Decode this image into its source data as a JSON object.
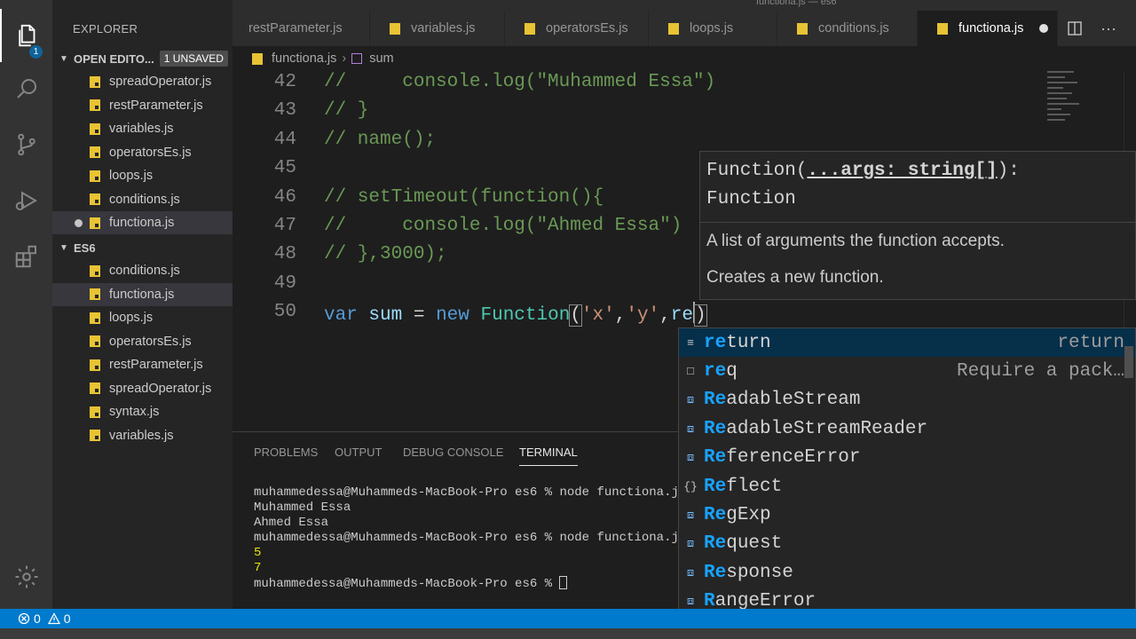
{
  "window": {
    "title": "functiona.js — es6"
  },
  "activity_bar": {
    "items": [
      {
        "name": "explorer-icon",
        "active": true,
        "badge": "1"
      },
      {
        "name": "search-icon"
      },
      {
        "name": "source-control-icon"
      },
      {
        "name": "run-debug-icon"
      },
      {
        "name": "extensions-icon"
      }
    ],
    "settings": "gear-icon"
  },
  "sidebar": {
    "title": "EXPLORER",
    "open_editors": {
      "label": "OPEN EDITO...",
      "badge": "1 UNSAVED",
      "files": [
        "spreadOperator.js",
        "restParameter.js",
        "variables.js",
        "operatorsEs.js",
        "loops.js",
        "conditions.js",
        "functiona.js"
      ]
    },
    "folder": {
      "label": "ES6",
      "files": [
        "conditions.js",
        "functiona.js",
        "loops.js",
        "operatorsEs.js",
        "restParameter.js",
        "spreadOperator.js",
        "syntax.js",
        "variables.js"
      ]
    }
  },
  "tabs": [
    {
      "label": "restParameter.js",
      "active": false
    },
    {
      "label": "variables.js",
      "active": false
    },
    {
      "label": "operatorsEs.js",
      "active": false
    },
    {
      "label": "loops.js",
      "active": false
    },
    {
      "label": "conditions.js",
      "active": false
    },
    {
      "label": "functiona.js",
      "active": true,
      "modified": true
    }
  ],
  "breadcrumb": {
    "file": "functiona.js",
    "symbol": "sum"
  },
  "editor": {
    "line_numbers": [
      "42",
      "43",
      "44",
      "45",
      "46",
      "47",
      "48",
      "49",
      "50"
    ],
    "lines": {
      "l42a": "//",
      "l42b": "console.log(\"Muhammed Essa\")",
      "l43": "// }",
      "l44": "// name();",
      "l46": "// setTimeout(function(){",
      "l47a": "//",
      "l47b": "console.log(\"Ahmed Essa\")",
      "l48": "// },3000);",
      "l50_kw": "var",
      "l50_var": "sum",
      "l50_eq": "=",
      "l50_new": "new",
      "l50_cls": "Function",
      "l50_open": "(",
      "l50_s1": "'x'",
      "l50_c1": ",",
      "l50_s2": "'y'",
      "l50_c2": ",",
      "l50_typed": "re",
      "l50_close": ")"
    }
  },
  "hover": {
    "sig_prefix": "Function(",
    "sig_param": "...args: string[]",
    "sig_suffix": "):",
    "sig_return": "Function",
    "param_doc": "A list of arguments the function accepts.",
    "doc": "Creates a new function."
  },
  "suggestions": [
    {
      "match": "re",
      "rest": "turn",
      "detail": "return",
      "icon": "keyword-icon",
      "focused": true
    },
    {
      "match": "re",
      "rest": "q",
      "detail": "Require a pack…",
      "icon": "snippet-icon"
    },
    {
      "match": "Re",
      "rest": "adableStream",
      "detail": "",
      "icon": "variable-icon"
    },
    {
      "match": "Re",
      "rest": "adableStreamReader",
      "detail": "",
      "icon": "variable-icon"
    },
    {
      "match": "Re",
      "rest": "ferenceError",
      "detail": "",
      "icon": "variable-icon"
    },
    {
      "match": "Re",
      "rest": "flect",
      "detail": "",
      "icon": "module-icon"
    },
    {
      "match": "Re",
      "rest": "gExp",
      "detail": "",
      "icon": "variable-icon"
    },
    {
      "match": "Re",
      "rest": "quest",
      "detail": "",
      "icon": "variable-icon"
    },
    {
      "match": "Re",
      "rest": "sponse",
      "detail": "",
      "icon": "variable-icon"
    },
    {
      "match": "R",
      "rest": "angeError",
      "detail": "",
      "icon": "variable-icon"
    }
  ],
  "panel": {
    "tabs": [
      "PROBLEMS",
      "OUTPUT",
      "DEBUG CONSOLE",
      "TERMINAL"
    ],
    "active_tab": "TERMINAL",
    "terminal": [
      {
        "text": "muhammedessa@Muhammeds-MacBook-Pro es6 % node functiona.j",
        "yellow": false
      },
      {
        "text": "Muhammed Essa",
        "yellow": false
      },
      {
        "text": "Ahmed Essa",
        "yellow": false
      },
      {
        "text": "muhammedessa@Muhammeds-MacBook-Pro es6 % node functiona.j",
        "yellow": false
      },
      {
        "text": "5",
        "yellow": true
      },
      {
        "text": "7",
        "yellow": true
      },
      {
        "text": "muhammedessa@Muhammeds-MacBook-Pro es6 % ",
        "yellow": false
      }
    ]
  },
  "status_bar": {
    "errors": "0",
    "warnings": "0"
  },
  "colors": {
    "accent": "#007acc",
    "js_icon": "#e8c334",
    "match": "#18a3ff"
  }
}
